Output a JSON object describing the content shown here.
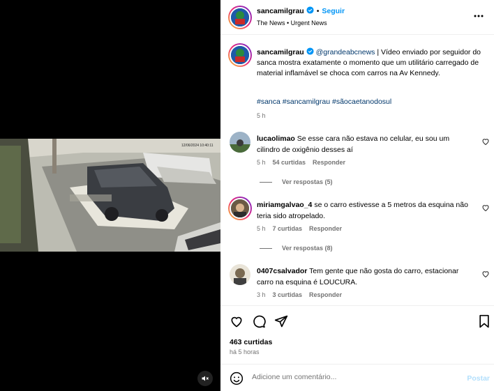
{
  "post": {
    "author": "sancamilgrau",
    "follow_label": "Seguir",
    "subtitle": "The News • Urgent News",
    "caption_mention": "@grandeabcnews",
    "caption_text": " | Vídeo enviado por seguidor do sanca mostra exatamente o momento que um utilitário carregado de material inflamável se choca com carros na Av Kennedy.",
    "hashtags": "#sanca #sancamilgrau #sãocaetanodosul",
    "caption_time": "5 h"
  },
  "comments": [
    {
      "username": "lucaolimao",
      "text": "Se esse cara não estava no celular, eu sou um cilindro de oxigênio desses aí",
      "time": "5 h",
      "likes": "54 curtidas",
      "reply": "Responder",
      "view_replies": "Ver respostas (5)"
    },
    {
      "username": "miriamgalvao_4",
      "text": "se o carro estivesse a 5 metros da esquina não teria sido atropelado.",
      "time": "5 h",
      "likes": "7 curtidas",
      "reply": "Responder",
      "view_replies": "Ver respostas (8)"
    },
    {
      "username": "0407csalvador",
      "text": "Tem gente que não gosta do carro, estacionar carro na esquina é LOUCURA.",
      "time": "3 h",
      "likes": "3 curtidas",
      "reply": "Responder"
    }
  ],
  "stats": {
    "likes": "463 curtidas",
    "time": "há 5 horas"
  },
  "add_comment": {
    "placeholder": "Adicione um comentário...",
    "post_label": "Postar"
  },
  "video": {
    "overlay_text": "12/06/2024 10:40:11"
  },
  "colors": {
    "link": "#0095f6",
    "hashtag": "#00376b",
    "muted": "#737373"
  }
}
